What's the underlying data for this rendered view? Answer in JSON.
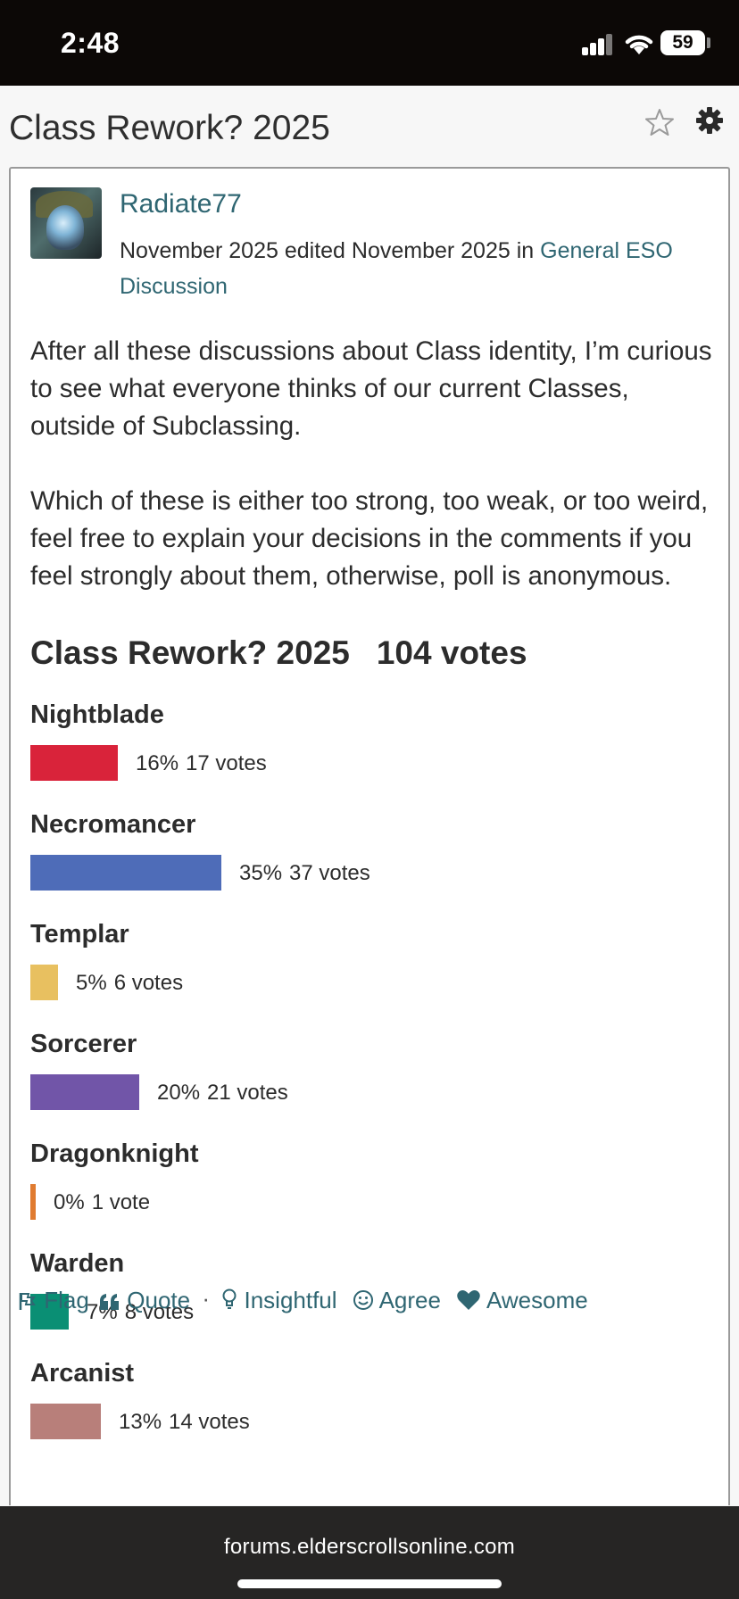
{
  "status_bar": {
    "time": "2:48",
    "battery": "59",
    "icons": [
      "signal-icon",
      "wifi-icon",
      "battery-icon"
    ]
  },
  "header": {
    "title": "Class Rework? 2025",
    "icons": [
      "star-icon",
      "gear-icon"
    ]
  },
  "post": {
    "author": "Radiate77",
    "meta_date": "November 2025 edited November 2025 in ",
    "category": "General ESO Discussion",
    "paragraphs": [
      "After all these discussions about Class identity, I’m curious to see what everyone thinks of our current Classes, outside of Subclassing.",
      "Which of these is either too strong, too weak, or too weird, feel free to explain your decisions in the comments if you feel strongly about them, otherwise, poll is anonymous."
    ]
  },
  "poll": {
    "title": "Class Rework? 2025",
    "total_votes": "104 votes",
    "options": [
      {
        "label": "Nightblade",
        "percent": "16%",
        "votes": "17 votes",
        "fraction": 0.16,
        "color": "#d9233a"
      },
      {
        "label": "Necromancer",
        "percent": "35%",
        "votes": "37 votes",
        "fraction": 0.35,
        "color": "#4e6cb8"
      },
      {
        "label": "Templar",
        "percent": "5%",
        "votes": "6 votes",
        "fraction": 0.05,
        "color": "#e8c060"
      },
      {
        "label": "Sorcerer",
        "percent": "20%",
        "votes": "21 votes",
        "fraction": 0.2,
        "color": "#7155a8"
      },
      {
        "label": "Dragonknight",
        "percent": "0%",
        "votes": "1 vote",
        "fraction": 0.01,
        "color": "#e07b30"
      },
      {
        "label": "Warden",
        "percent": "7%",
        "votes": "8 votes",
        "fraction": 0.07,
        "color": "#0a8f74"
      },
      {
        "label": "Arcanist",
        "percent": "13%",
        "votes": "14 votes",
        "fraction": 0.13,
        "color": "#b87f7a"
      }
    ]
  },
  "reactions": {
    "flag": "Flag",
    "quote": "Quote",
    "separator": "·",
    "insightful": "Insightful",
    "agree": "Agree",
    "awesome": "Awesome"
  },
  "browser": {
    "url": "forums.elderscrollsonline.com"
  },
  "colors": {
    "link": "#2f6672",
    "status_bar": "#0c0806",
    "url_bar": "#262524"
  }
}
